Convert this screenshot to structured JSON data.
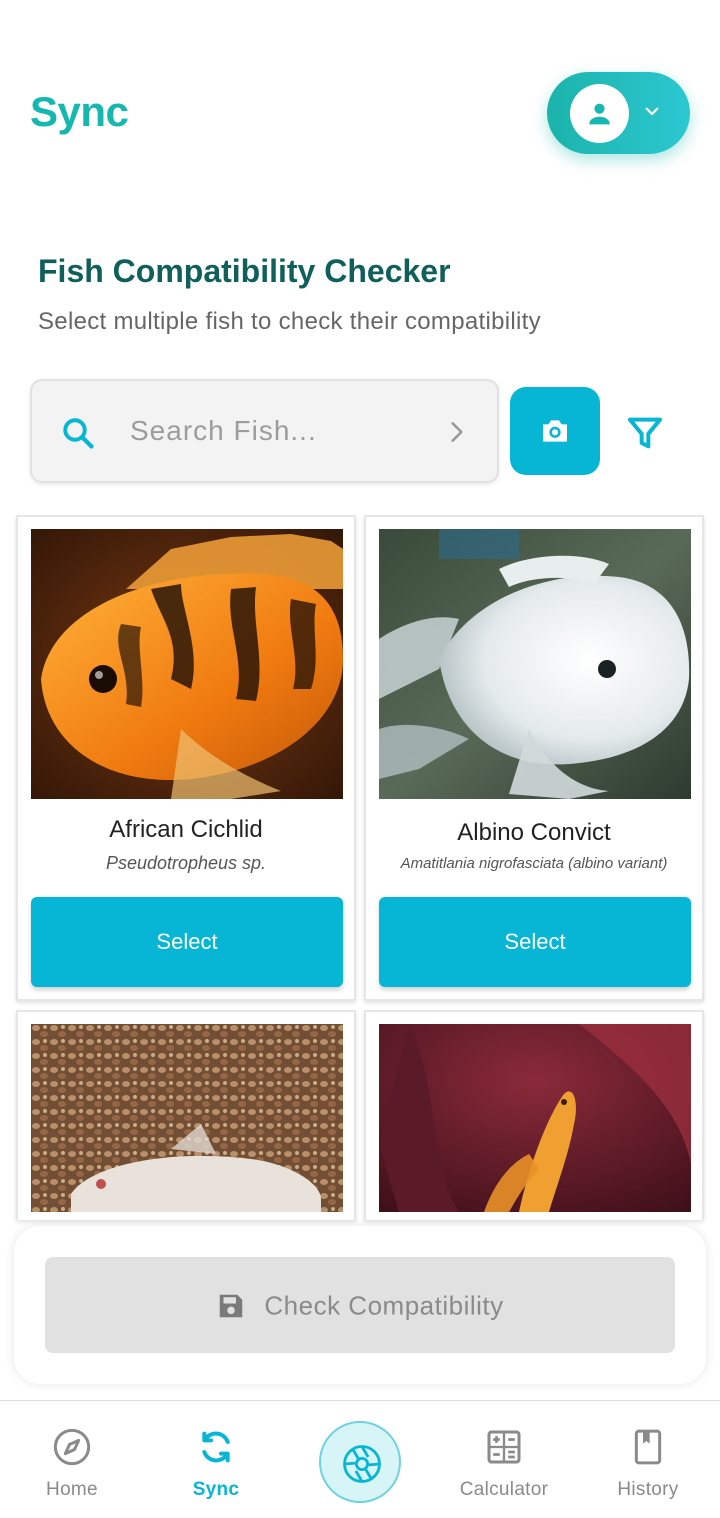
{
  "header": {
    "title": "Sync"
  },
  "section": {
    "title": "Fish Compatibility Checker",
    "subtitle": "Select multiple fish to check their compatibility"
  },
  "search": {
    "placeholder": "Search Fish..."
  },
  "fish": [
    {
      "name": "African Cichlid",
      "scientific": "Pseudotropheus sp.",
      "button": "Select"
    },
    {
      "name": "Albino Convict",
      "scientific": "Amatitlania nigrofasciata (albino variant)",
      "button": "Select"
    },
    {
      "name": "",
      "scientific": "",
      "button": ""
    },
    {
      "name": "",
      "scientific": "",
      "button": ""
    }
  ],
  "action": {
    "check_label": "Check Compatibility"
  },
  "nav": {
    "items": [
      {
        "label": "Home",
        "icon": "compass-icon"
      },
      {
        "label": "Sync",
        "icon": "sync-icon"
      },
      {
        "label": "",
        "icon": "aperture-icon"
      },
      {
        "label": "Calculator",
        "icon": "calculator-icon"
      },
      {
        "label": "History",
        "icon": "bookmark-book-icon"
      }
    ]
  },
  "colors": {
    "accent": "#06b6d4",
    "brand": "#14b8b0",
    "heading": "#0f5f5a"
  }
}
